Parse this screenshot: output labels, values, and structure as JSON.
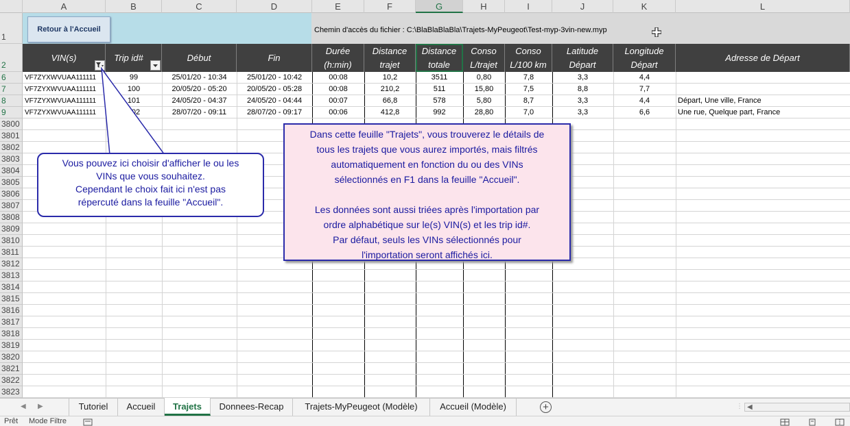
{
  "columns": [
    "A",
    "B",
    "C",
    "D",
    "E",
    "F",
    "G",
    "H",
    "I",
    "J",
    "K",
    "L"
  ],
  "row_numbers": [
    "1",
    "2",
    "6",
    "7",
    "8",
    "9",
    "3800",
    "3801",
    "3802",
    "3803",
    "3804",
    "3805",
    "3806",
    "3807",
    "3808",
    "3809",
    "3810",
    "3811",
    "3812",
    "3813",
    "3814",
    "3815",
    "3816",
    "3817",
    "3818",
    "3819",
    "3820",
    "3821",
    "3822",
    "3823"
  ],
  "back_button": "Retour à l'Accueil",
  "path_label": "Chemin d'accès du fichier : C:\\BlaBlaBlaBla\\Trajets-MyPeugeot\\Test-myp-3vin-new.myp",
  "headers": [
    {
      "l1": "VIN(s)",
      "l2": ""
    },
    {
      "l1": "Trip id#",
      "l2": ""
    },
    {
      "l1": "Début",
      "l2": ""
    },
    {
      "l1": "Fin",
      "l2": ""
    },
    {
      "l1": "Durée",
      "l2": "(h:min)"
    },
    {
      "l1": "Distance",
      "l2": "trajet"
    },
    {
      "l1": "Distance",
      "l2": "totale"
    },
    {
      "l1": "Conso",
      "l2": "L/trajet"
    },
    {
      "l1": "Conso",
      "l2": "L/100 km"
    },
    {
      "l1": "Latitude",
      "l2": "Départ"
    },
    {
      "l1": "Longitude",
      "l2": "Départ"
    },
    {
      "l1": "Adresse de Départ",
      "l2": ""
    }
  ],
  "rows": [
    [
      "VF7ZYXWVUAA111111",
      "99",
      "25/01/20 - 10:34",
      "25/01/20 - 10:42",
      "00:08",
      "10,2",
      "3511",
      "0,80",
      "7,8",
      "3,3",
      "4,4",
      ""
    ],
    [
      "VF7ZYXWVUAA111111",
      "100",
      "20/05/20 - 05:20",
      "20/05/20 - 05:28",
      "00:08",
      "210,2",
      "511",
      "15,80",
      "7,5",
      "8,8",
      "7,7",
      ""
    ],
    [
      "VF7ZYXWVUAA111111",
      "101",
      "24/05/20 - 04:37",
      "24/05/20 - 04:44",
      "00:07",
      "66,8",
      "578",
      "5,80",
      "8,7",
      "3,3",
      "4,4",
      "Départ, Une ville, France"
    ],
    [
      "VF7ZYXWVUAA111111",
      "102",
      "28/07/20 - 09:11",
      "28/07/20 - 09:17",
      "00:06",
      "412,8",
      "992",
      "28,80",
      "7,0",
      "3,3",
      "6,6",
      "Une rue, Quelque part, France"
    ]
  ],
  "callout_left": [
    "Vous pouvez ici choisir d'afficher le ou les",
    "VINs que vous souhaitez.",
    "Cependant le choix fait ici n'est pas",
    "répercuté dans la feuille \"Accueil\"."
  ],
  "callout_main": [
    "Dans cette feuille \"Trajets\", vous trouverez le détails de",
    "tous les trajets que vous aurez importés, mais filtrés",
    "automatiquement en fonction du ou des VINs",
    "sélectionnés en F1 dans la feuille \"Accueil\".",
    "",
    "Les données sont aussi triées après l'importation par",
    "ordre alphabétique sur le(s) VIN(s) et les trip id#.",
    "Par défaut, seuls les VINs sélectionnés pour",
    "l'importation seront affichés ici."
  ],
  "tabs": [
    "Tutoriel",
    "Accueil",
    "Trajets",
    "Donnees-Recap",
    "Trajets-MyPeugeot (Modèle)",
    "Accueil (Modèle)"
  ],
  "active_tab": "Trajets",
  "status": {
    "ready": "Prêt",
    "mode": "Mode Filtre"
  },
  "colors": {
    "accent": "#217346",
    "header_bg": "#404040",
    "callout_text": "#1a1aa0",
    "callout_fill": "#fce4ec"
  }
}
